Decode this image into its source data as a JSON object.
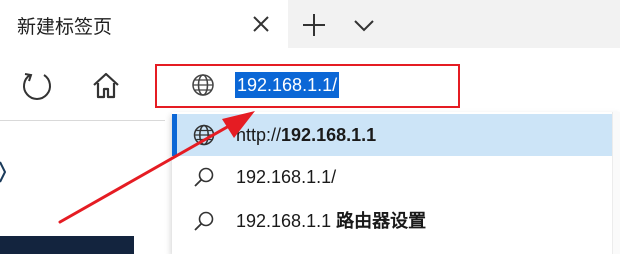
{
  "tab": {
    "title": "新建标签页"
  },
  "icons": {
    "close": "close-icon",
    "new_tab": "plus-icon",
    "tab_list": "chevron-down-icon",
    "refresh": "refresh-icon",
    "home": "home-icon",
    "globe": "globe-icon",
    "search": "search-icon"
  },
  "address_bar": {
    "value": "192.168.1.1/"
  },
  "suggestions": [
    {
      "prefix": "http://",
      "bold": "192.168.1.1",
      "suffix": "",
      "icon": "globe-icon",
      "selected": true
    },
    {
      "prefix": "192.168.1.1/",
      "bold": "",
      "suffix": "",
      "icon": "search-icon",
      "selected": false
    },
    {
      "prefix": "192.168.1.1 ",
      "bold": "路由器设置",
      "suffix": "",
      "icon": "search-icon",
      "selected": false
    }
  ],
  "colors": {
    "accent": "#0b67d6",
    "selected_row": "#cce4f7",
    "annotation_red": "#e51c23",
    "tab_strip": "#f2f2f2"
  }
}
